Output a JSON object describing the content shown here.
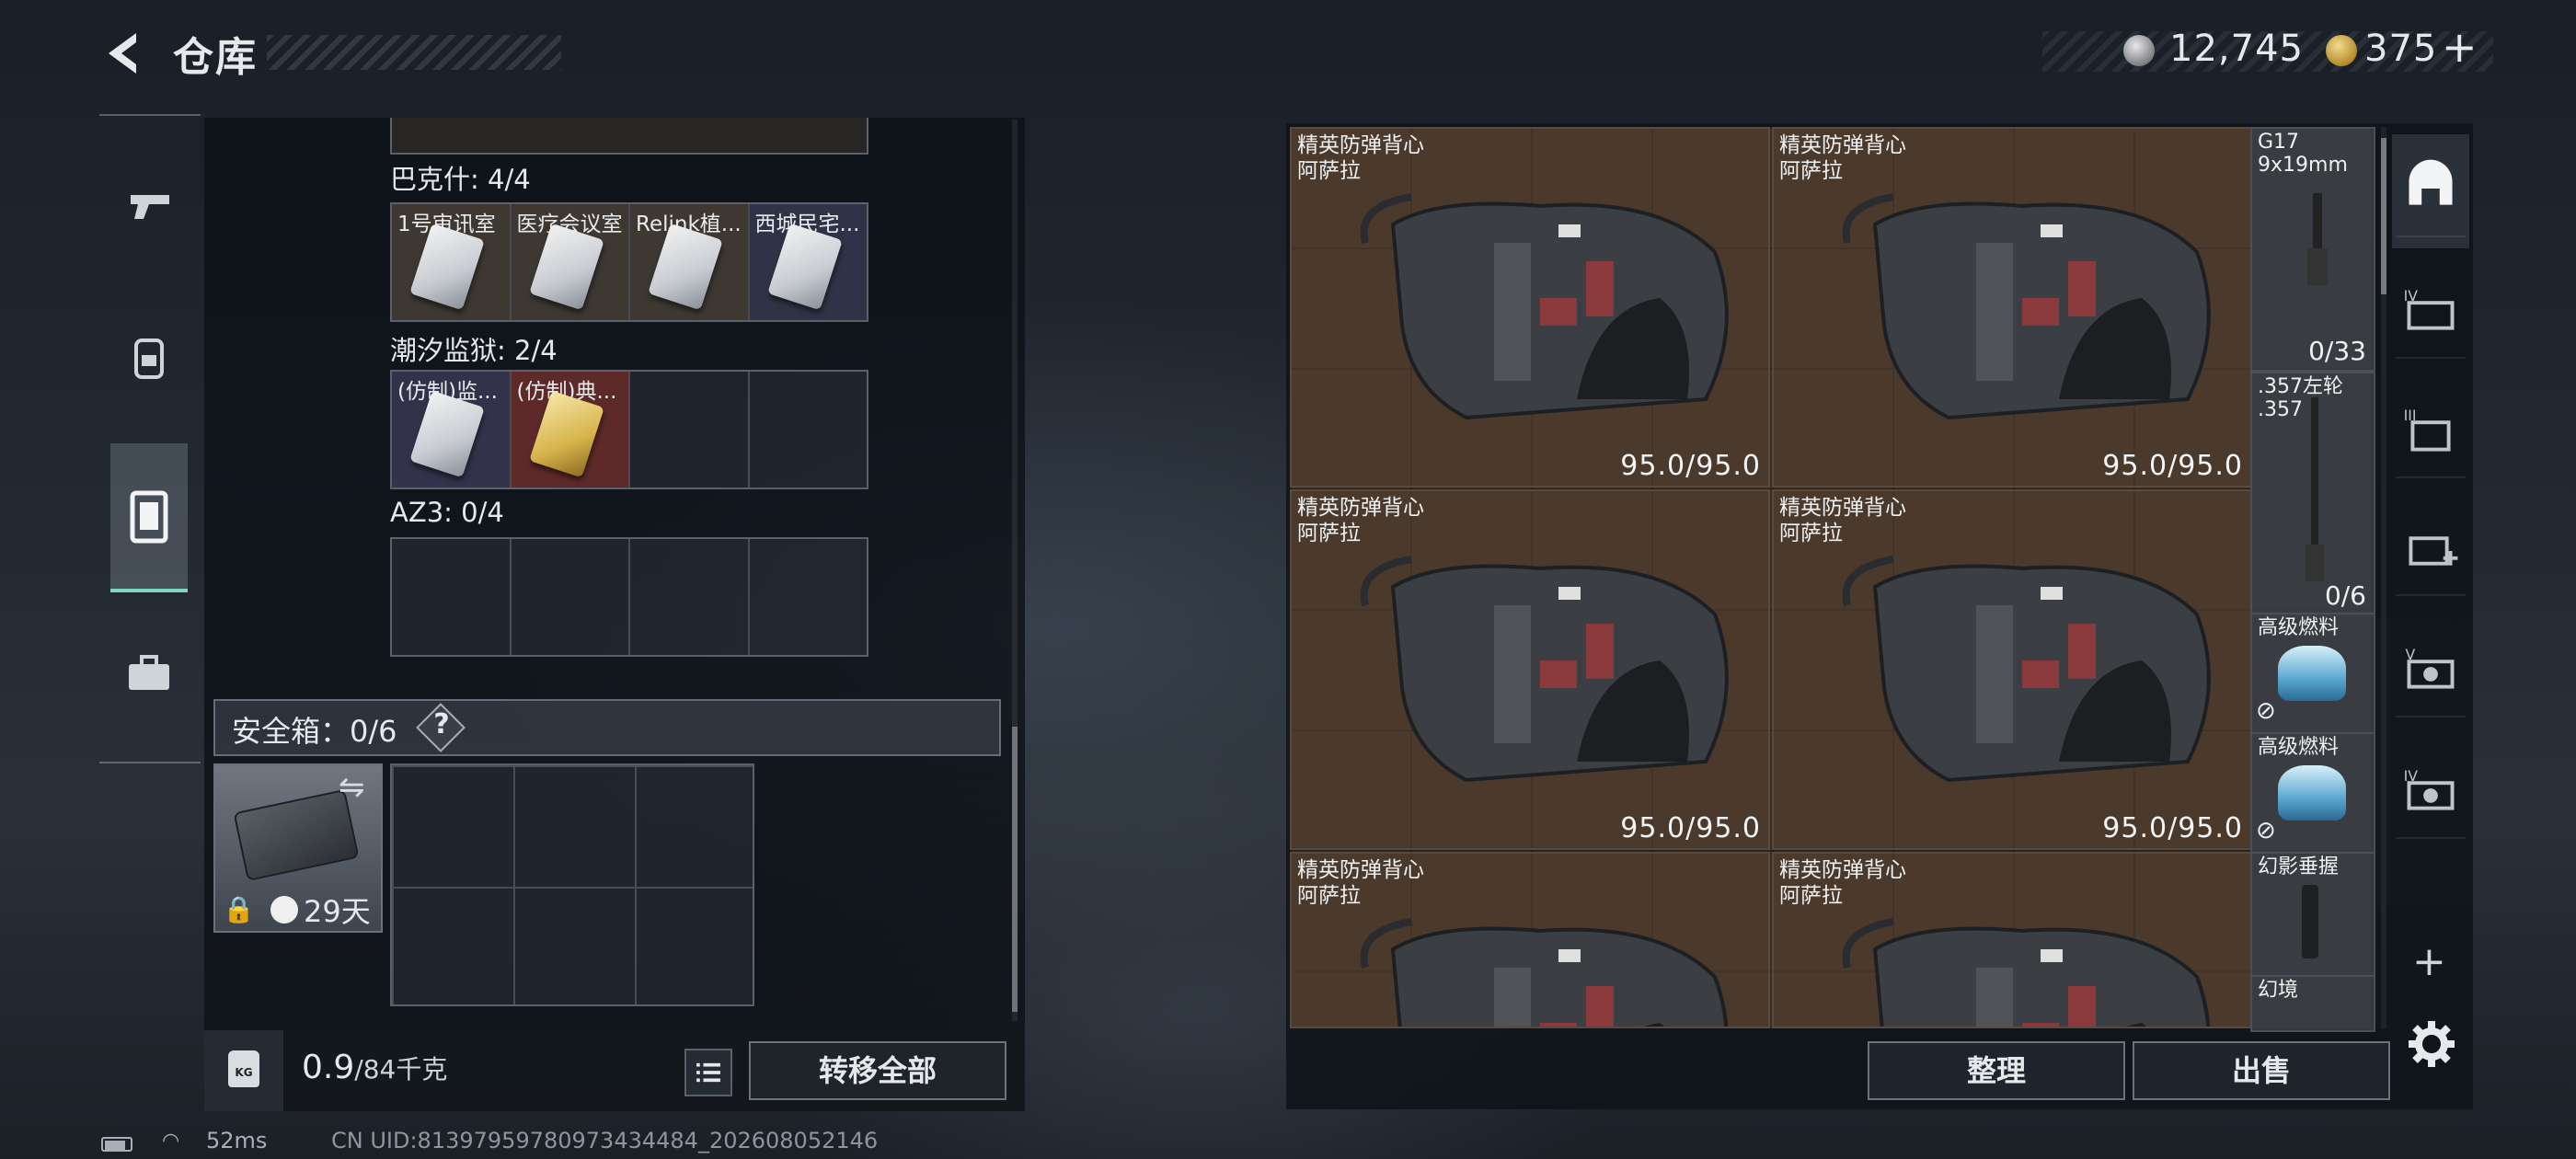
{
  "header": {
    "title": "仓库",
    "currency_silver": "12,745",
    "currency_gold": "375",
    "add_label": "+",
    "version": ""
  },
  "left_nav": {
    "items": [
      "weapons",
      "backpack",
      "storage",
      "toolbox"
    ]
  },
  "storage_groups": [
    {
      "label": "巴克什: 4/4",
      "slots": [
        "1号审讯室",
        "医疗会议室",
        "Relink植...",
        "西城民宅..."
      ]
    },
    {
      "label": "潮汐监狱: 2/4",
      "slots": [
        "(仿制)监...",
        "(仿制)典...",
        "",
        ""
      ]
    },
    {
      "label": "AZ3: 0/4",
      "slots": [
        "",
        "",
        "",
        ""
      ]
    }
  ],
  "safe_box": {
    "label": "安全箱：0/6",
    "help": "?",
    "days": "29天"
  },
  "footer": {
    "weight": "0.9",
    "weight_cap": "/84千克",
    "transfer_label": "转移全部",
    "kg_label": "KG"
  },
  "status": {
    "ping": "52ms",
    "uid": "CN UID:81397959780973434484_202608052146"
  },
  "stash": {
    "vests": [
      {
        "line1": "精英防弹背心",
        "line2": "阿萨拉",
        "durability": "95.0/95.0"
      },
      {
        "line1": "精英防弹背心",
        "line2": "阿萨拉",
        "durability": "95.0/95.0"
      },
      {
        "line1": "精英防弹背心",
        "line2": "阿萨拉",
        "durability": "95.0/95.0"
      },
      {
        "line1": "精英防弹背心",
        "line2": "阿萨拉",
        "durability": "95.0/95.0"
      },
      {
        "line1": "精英防弹背心",
        "line2": "阿萨拉",
        "durability": ""
      },
      {
        "line1": "精英防弹背心",
        "line2": "阿萨拉",
        "durability": ""
      }
    ],
    "side_items": [
      {
        "line1": "G17",
        "line2": "9x19mm",
        "count": "0/33"
      },
      {
        "line1": ".357左轮",
        "line2": ".357",
        "count": "0/6"
      },
      {
        "line1": "高级燃料",
        "line2": "",
        "count": ""
      },
      {
        "line1": "高级燃料",
        "line2": "",
        "count": ""
      },
      {
        "line1": "幻影垂握",
        "line2": "",
        "count": ""
      },
      {
        "line1": "幻境",
        "line2": "",
        "count": ""
      }
    ],
    "sort_label": "整理",
    "sell_label": "出售"
  },
  "right_rail": {
    "add_label": "+"
  },
  "colors": {
    "accent": "#7fd6c2",
    "stash_bg": "#3a2f27",
    "panel_bg": "#0c1016"
  }
}
